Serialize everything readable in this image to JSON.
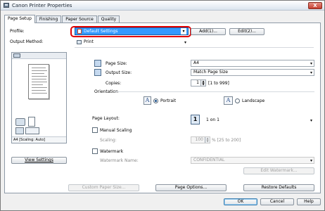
{
  "window": {
    "title": "Canon Printer Properties",
    "close_label": "X"
  },
  "tabs": [
    "Page Setup",
    "Finishing",
    "Paper Source",
    "Quality"
  ],
  "profile": {
    "label": "Profile:",
    "value": "Default Settings",
    "add_label": "Add(1)...",
    "edit_label": "Edit(2)..."
  },
  "output_method": {
    "label": "Output Method:",
    "value": "Print"
  },
  "preview": {
    "caption": "A4 [Scaling: Auto]",
    "view_settings_label": "View Settings"
  },
  "page_size": {
    "label": "Page Size:",
    "value": "A4"
  },
  "output_size": {
    "label": "Output Size:",
    "value": "Match Page Size"
  },
  "copies": {
    "label": "Copies:",
    "value": "1",
    "range": "[1 to 999]"
  },
  "orientation": {
    "label": "Orientation",
    "portrait_label": "Portrait",
    "landscape_label": "Landscape",
    "selected": "Portrait"
  },
  "page_layout": {
    "label": "Page Layout:",
    "value": "1 on 1",
    "icon_text": "1"
  },
  "manual_scaling": {
    "label": "Manual Scaling",
    "scaling_label": "Scaling:",
    "value": "100",
    "range": "% [25 to 200]"
  },
  "watermark": {
    "label": "Watermark",
    "name_label": "Watermark Name:",
    "value": "CONFIDENTIAL",
    "edit_label": "Edit Watermark..."
  },
  "bottom_buttons": {
    "custom_paper": "Custom Paper Size...",
    "page_options": "Page Options...",
    "restore_defaults": "Restore Defaults"
  },
  "dialog_buttons": {
    "ok": "OK",
    "cancel": "Cancel",
    "help": "Help"
  },
  "colors": {
    "selection": "#3399ff",
    "highlight": "#e00000"
  }
}
